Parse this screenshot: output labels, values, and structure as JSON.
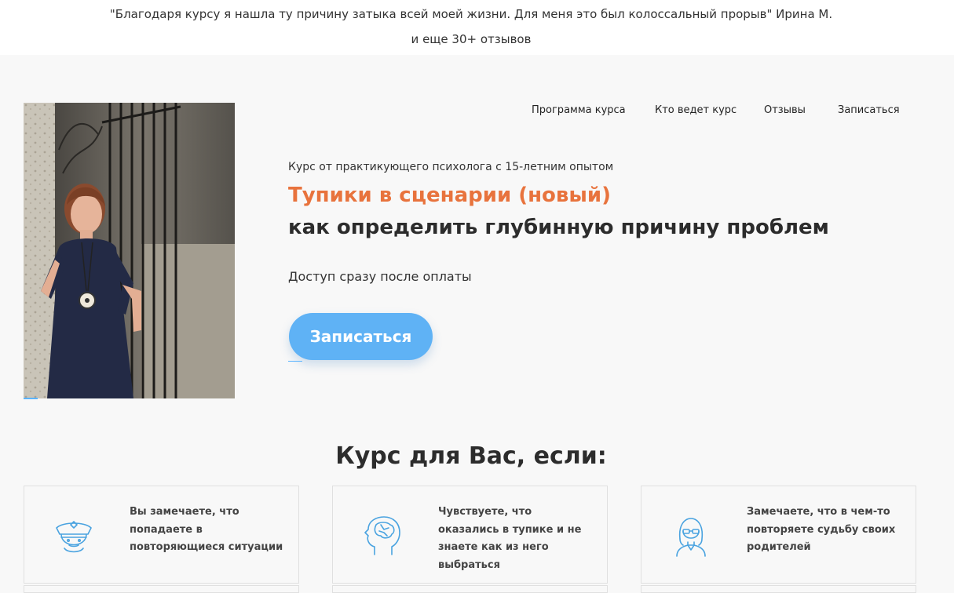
{
  "testimonial": {
    "quote": "\"Благодаря курсу я нашла ту причину затыка всей моей жизни. Для меня это был колоссальный прорыв\" Ирина М.",
    "count": "и еще 30+ отзывов"
  },
  "nav": {
    "items": [
      {
        "label": "Программа курса"
      },
      {
        "label": "Кто ведет курс"
      },
      {
        "label": "Отзывы"
      },
      {
        "label": "Записаться"
      }
    ]
  },
  "hero": {
    "subtitle": "Курс от практикующего психолога с 15-летним опытом",
    "title_accent": "Тупики в сценарии (новый)",
    "title_main": "как определить глубинную причину проблем",
    "access": "Доступ сразу после оплаты",
    "cta_label": "Записаться"
  },
  "section": {
    "title": "Курс для Вас, если:"
  },
  "cards": [
    {
      "text": "Вы замечаете, что попадаете в повторяющиеся ситуации",
      "icon": "police-face-icon"
    },
    {
      "text": "Чувствуете, что оказались в тупике и не знаете как из него выбраться",
      "icon": "brain-head-icon"
    },
    {
      "text": "Замечаете, что в чем-то повторяете судьбу своих родителей",
      "icon": "woman-glasses-icon"
    }
  ],
  "colors": {
    "accent_orange": "#e8733d",
    "button_blue": "#5fb2f5",
    "icon_blue": "#4aa3e0"
  }
}
